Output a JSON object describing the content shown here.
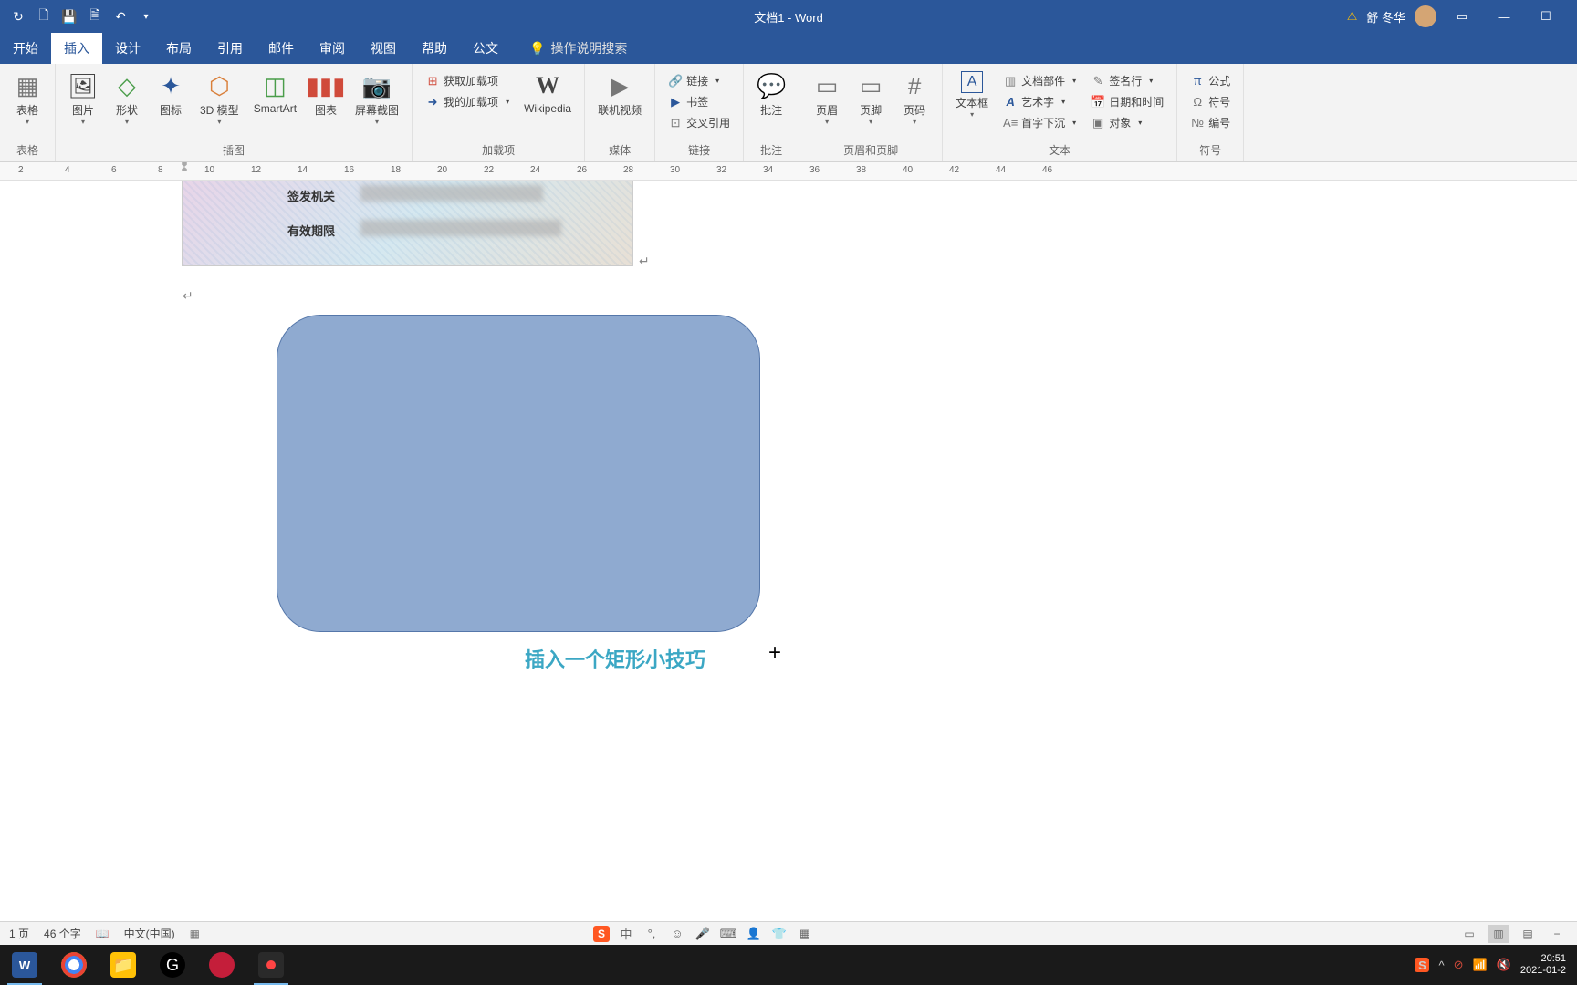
{
  "titlebar": {
    "doc_title": "文档1 - Word",
    "username": "舒 冬华"
  },
  "tabs": {
    "items": [
      "开始",
      "插入",
      "设计",
      "布局",
      "引用",
      "邮件",
      "审阅",
      "视图",
      "帮助",
      "公文"
    ],
    "active_index": 1,
    "tellme": "操作说明搜索"
  },
  "ribbon": {
    "groups": [
      {
        "label": "表格",
        "buttons": [
          {
            "label": "表格",
            "icon": "▦"
          }
        ]
      },
      {
        "label": "插图",
        "buttons": [
          {
            "label": "图片",
            "icon": "🖼"
          },
          {
            "label": "形状",
            "icon": "◇"
          },
          {
            "label": "图标",
            "icon": "✦"
          },
          {
            "label": "3D 模型",
            "icon": "⬡"
          },
          {
            "label": "SmartArt",
            "icon": "◫"
          },
          {
            "label": "图表",
            "icon": "▮"
          },
          {
            "label": "屏幕截图",
            "icon": "📷"
          }
        ]
      },
      {
        "label": "加载项",
        "rows": [
          {
            "label": "获取加载项",
            "icon": "⊞"
          },
          {
            "label": "我的加载项",
            "icon": "➜"
          }
        ],
        "side": {
          "label": "Wikipedia",
          "icon": "W"
        }
      },
      {
        "label": "媒体",
        "buttons": [
          {
            "label": "联机视频",
            "icon": "▶"
          }
        ]
      },
      {
        "label": "链接",
        "rows": [
          {
            "label": "链接",
            "icon": "🔗"
          },
          {
            "label": "书签",
            "icon": "▶"
          },
          {
            "label": "交叉引用",
            "icon": "⊡"
          }
        ]
      },
      {
        "label": "批注",
        "buttons": [
          {
            "label": "批注",
            "icon": "💬"
          }
        ]
      },
      {
        "label": "页眉和页脚",
        "buttons": [
          {
            "label": "页眉",
            "icon": "▭"
          },
          {
            "label": "页脚",
            "icon": "▭"
          },
          {
            "label": "页码",
            "icon": "#"
          }
        ]
      },
      {
        "label": "文本",
        "buttons": [
          {
            "label": "文本框",
            "icon": "A"
          }
        ],
        "rows": [
          {
            "label": "文档部件",
            "icon": "▥"
          },
          {
            "label": "艺术字",
            "icon": "A"
          },
          {
            "label": "首字下沉",
            "icon": "A≡"
          }
        ],
        "rows2": [
          {
            "label": "签名行",
            "icon": "✎"
          },
          {
            "label": "日期和时间",
            "icon": "📅"
          },
          {
            "label": "对象",
            "icon": "▣"
          }
        ]
      },
      {
        "label": "符号",
        "rows": [
          {
            "label": "公式",
            "icon": "π"
          },
          {
            "label": "符号",
            "icon": "Ω"
          },
          {
            "label": "编号",
            "icon": "№"
          }
        ]
      }
    ]
  },
  "document": {
    "idcard": {
      "row1_label": "签发机关",
      "row2_label": "有效期限"
    },
    "shape_caption": "插入一个矩形小技巧"
  },
  "statusbar": {
    "page": "1 页",
    "words": "46 个字",
    "lang": "中文(中国)",
    "ime_label": "中"
  },
  "tray": {
    "time": "20:51",
    "date": "2021-01-2"
  },
  "ruler_marks": [
    2,
    4,
    6,
    8,
    10,
    12,
    14,
    16,
    18,
    20,
    22,
    24,
    26,
    28,
    30,
    32,
    34,
    36,
    38,
    40,
    42,
    44,
    46
  ]
}
